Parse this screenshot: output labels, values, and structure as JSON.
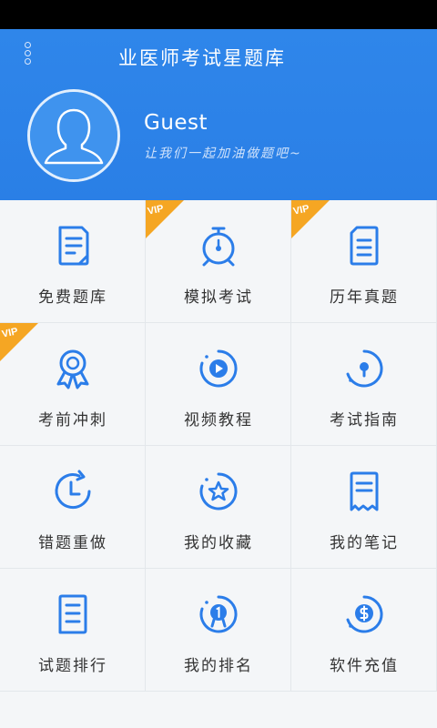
{
  "header": {
    "app_title": "业医师考试星题库",
    "username": "Guest",
    "slogan": "让我们一起加油做题吧~"
  },
  "vip_label": "VIP",
  "colors": {
    "primary": "#2a7fe6",
    "icon": "#2b7de9",
    "vip": "#f5a623"
  },
  "grid": {
    "items": [
      {
        "label": "免费题库",
        "icon": "document-icon",
        "vip": false
      },
      {
        "label": "模拟考试",
        "icon": "stopwatch-icon",
        "vip": true
      },
      {
        "label": "历年真题",
        "icon": "list-document-icon",
        "vip": true
      },
      {
        "label": "考前冲刺",
        "icon": "award-ribbon-icon",
        "vip": true
      },
      {
        "label": "视频教程",
        "icon": "play-circle-icon",
        "vip": false
      },
      {
        "label": "考试指南",
        "icon": "location-pin-icon",
        "vip": false
      },
      {
        "label": "错题重做",
        "icon": "clock-redo-icon",
        "vip": false
      },
      {
        "label": "我的收藏",
        "icon": "star-circle-icon",
        "vip": false
      },
      {
        "label": "我的笔记",
        "icon": "receipt-note-icon",
        "vip": false
      },
      {
        "label": "试题排行",
        "icon": "ranking-list-icon",
        "vip": false
      },
      {
        "label": "我的排名",
        "icon": "medal-icon",
        "vip": false
      },
      {
        "label": "软件充值",
        "icon": "coin-recharge-icon",
        "vip": false
      }
    ]
  }
}
